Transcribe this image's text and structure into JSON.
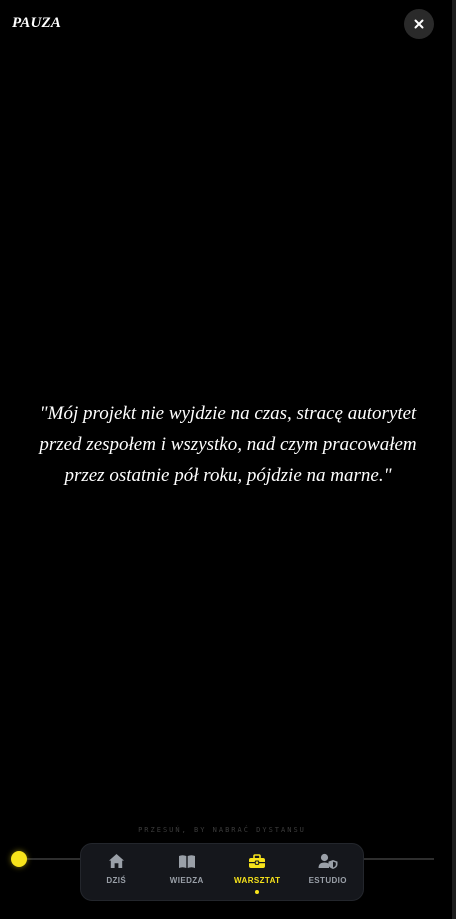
{
  "header": {
    "title": "PAUZA",
    "close_icon": "close-icon",
    "close_symbol": "×"
  },
  "quote": {
    "text": "\"Mój projekt nie wyjdzie na czas, stracę autorytet przed zespołem i wszystko, nad czym pracowałem przez ostatnie pół roku, pójdzie na marne.\""
  },
  "slider": {
    "hint": "PRZESUŃ, BY NABRAĆ DYSTANSU",
    "value": 0
  },
  "nav": {
    "items": [
      {
        "label": "DZIŚ",
        "icon": "home-icon",
        "active": false
      },
      {
        "label": "WIEDZA",
        "icon": "book-icon",
        "active": false
      },
      {
        "label": "WARSZTAT",
        "icon": "toolbox-icon",
        "active": true
      },
      {
        "label": "ESTUDIO",
        "icon": "user-shield-icon",
        "active": false
      }
    ]
  },
  "colors": {
    "accent": "#f7e31b",
    "background": "#000000",
    "nav_background": "#15171c",
    "nav_inactive": "#9aa0a8"
  }
}
